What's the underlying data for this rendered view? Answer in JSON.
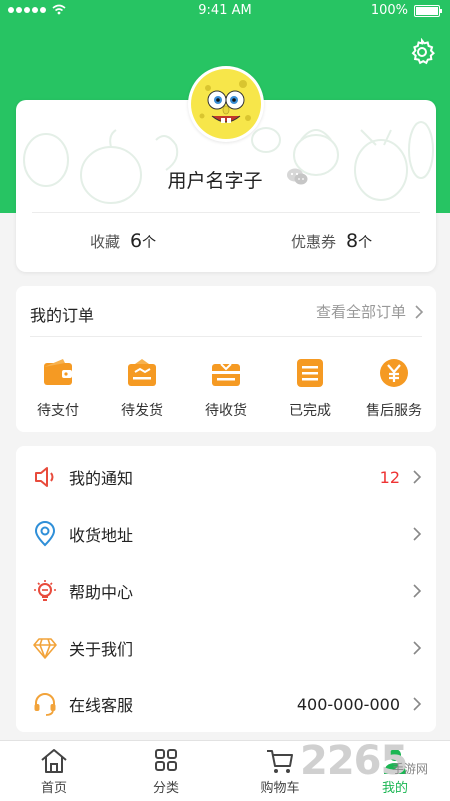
{
  "status_bar": {
    "time": "9:41 AM",
    "battery": "100%"
  },
  "profile": {
    "username": "用户名字子",
    "favorites_label": "收藏",
    "favorites_count": "6",
    "favorites_unit": "个",
    "coupons_label": "优惠券",
    "coupons_count": "8",
    "coupons_unit": "个"
  },
  "orders": {
    "title": "我的订单",
    "view_all": "查看全部订单",
    "items": [
      {
        "label": "待支付",
        "icon": "wallet-icon"
      },
      {
        "label": "待发货",
        "icon": "package-ship-icon"
      },
      {
        "label": "待收货",
        "icon": "package-receive-icon"
      },
      {
        "label": "已完成",
        "icon": "completed-list-icon"
      },
      {
        "label": "售后服务",
        "icon": "yen-service-icon"
      }
    ]
  },
  "menu": [
    {
      "label": "我的通知",
      "value": "12",
      "icon": "speaker-icon"
    },
    {
      "label": "收货地址",
      "value": "",
      "icon": "location-pin-icon"
    },
    {
      "label": "帮助中心",
      "value": "",
      "icon": "lightbulb-icon"
    },
    {
      "label": "关于我们",
      "value": "",
      "icon": "diamond-icon"
    },
    {
      "label": "在线客服",
      "value": "400-000-000",
      "icon": "headset-icon"
    }
  ],
  "tabbar": [
    {
      "label": "首页",
      "icon": "home-icon"
    },
    {
      "label": "分类",
      "icon": "category-icon"
    },
    {
      "label": "购物车",
      "icon": "cart-icon"
    },
    {
      "label": "我的",
      "icon": "user-icon"
    }
  ],
  "watermark": {
    "number": "2265",
    "text": "手游网"
  },
  "colors": {
    "brand_green": "#27c463",
    "active_tab_green": "#1bb653",
    "order_icon_orange": "#f59a23",
    "notification_red": "#e33333"
  }
}
